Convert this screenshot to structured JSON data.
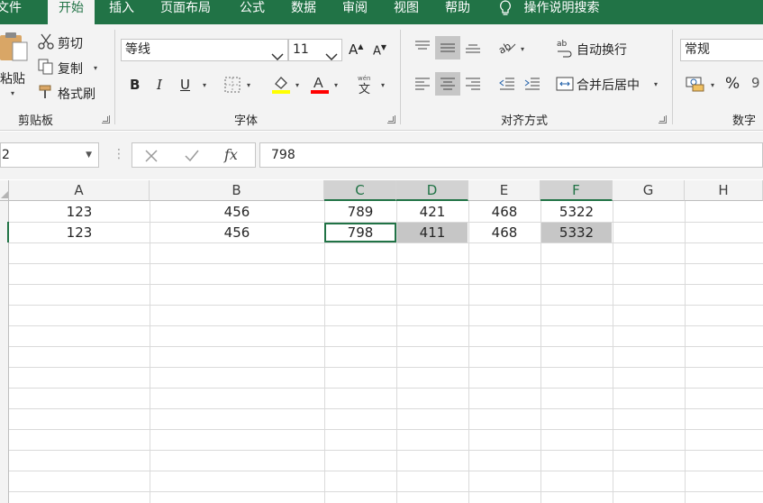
{
  "ribbon_tabs": [
    {
      "label": "文件"
    },
    {
      "label": "开始"
    },
    {
      "label": "插入"
    },
    {
      "label": "页面布局"
    },
    {
      "label": "公式"
    },
    {
      "label": "数据"
    },
    {
      "label": "审阅"
    },
    {
      "label": "视图"
    },
    {
      "label": "帮助"
    },
    {
      "label": "操作说明搜索"
    }
  ],
  "clipboard": {
    "paste_label": "粘贴",
    "cut_label": "剪切",
    "copy_label": "复制",
    "format_painter_label": "格式刷",
    "group_label": "剪贴板"
  },
  "font": {
    "font_name": "等线",
    "font_size": "11",
    "bold_label": "B",
    "italic_label": "I",
    "underline_label": "U",
    "group_label": "字体",
    "fill_color": "#ffff00",
    "font_color": "#ff0000"
  },
  "alignment": {
    "wrap_text_label": "自动换行",
    "merge_center_label": "合并后居中",
    "group_label": "对齐方式"
  },
  "number": {
    "format_value": "常规",
    "percent_label": "%",
    "group_label": "数字"
  },
  "formula_bar": {
    "name_box": "2",
    "fx_label": "fx",
    "formula": "798"
  },
  "columns": [
    "A",
    "B",
    "C",
    "D",
    "E",
    "F",
    "G",
    "H"
  ],
  "rows": [
    {
      "A": "123",
      "B": "456",
      "C": "789",
      "D": "421",
      "E": "468",
      "F": "5322"
    },
    {
      "A": "123",
      "B": "456",
      "C": "798",
      "D": "411",
      "E": "468",
      "F": "5332"
    }
  ],
  "colors": {
    "accent": "#217346",
    "highlight_fill": "#c6c6c6"
  }
}
